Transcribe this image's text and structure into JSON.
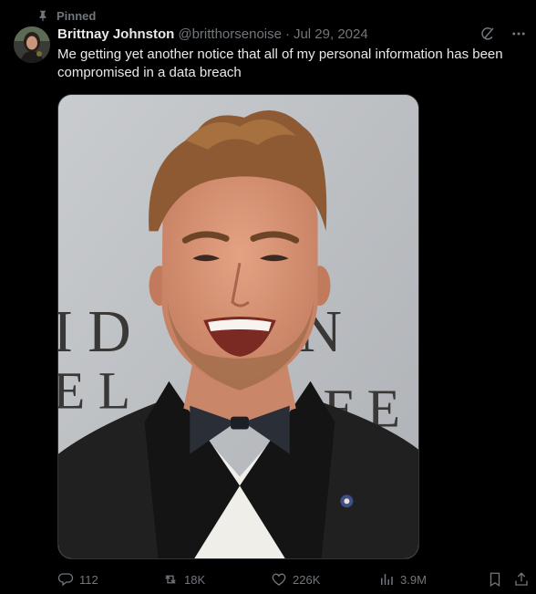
{
  "pinned": {
    "label": "Pinned",
    "icon": "pin-icon"
  },
  "author": {
    "display_name": "Brittnay Johnston",
    "handle": "@britthorsenoise",
    "separator": "·",
    "date": "Jul 29, 2024"
  },
  "tweet": {
    "text": "Me getting yet another notice that all of my personal information has been compromised in a data breach"
  },
  "media": {
    "description_icon": "photo",
    "backdrop_lettering": [
      "I D   N",
      "E L   F E"
    ]
  },
  "header_icons": [
    "grok-icon",
    "more-icon"
  ],
  "actions": {
    "reply": {
      "icon": "reply-icon",
      "count": "112"
    },
    "retweet": {
      "icon": "retweet-icon",
      "count": "18K"
    },
    "like": {
      "icon": "heart-icon",
      "count": "226K"
    },
    "views": {
      "icon": "views-icon",
      "count": "3.9M"
    },
    "bookmark": {
      "icon": "bookmark-icon"
    },
    "share": {
      "icon": "share-icon"
    }
  },
  "colors": {
    "background": "#000000",
    "text_primary": "#e7e9ea",
    "text_secondary": "#71767b",
    "border": "#2f3336"
  }
}
